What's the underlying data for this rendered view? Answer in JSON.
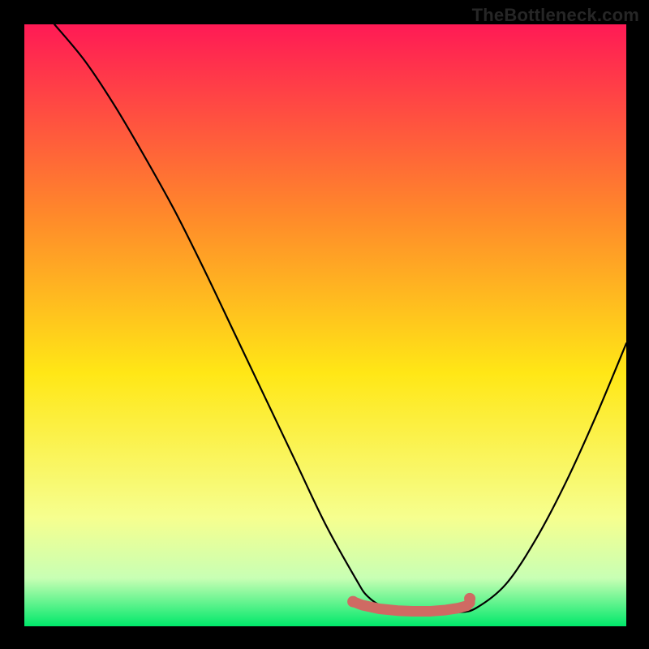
{
  "watermark": "TheBottleneck.com",
  "colors": {
    "bg": "#000000",
    "grad_top": "#ff1a55",
    "grad_mid1": "#ff8a2a",
    "grad_mid2": "#ffe716",
    "grad_low1": "#f6ff8f",
    "grad_low2": "#c8ffb4",
    "grad_bottom": "#00e86a",
    "curve": "#000000",
    "marker": "#cf6a63"
  },
  "chart_data": {
    "type": "line",
    "title": "",
    "xlabel": "",
    "ylabel": "",
    "xlim": [
      0,
      100
    ],
    "ylim": [
      0,
      100
    ],
    "curve_x": [
      5,
      10,
      15,
      20,
      25,
      30,
      35,
      40,
      45,
      50,
      55,
      57,
      60,
      63,
      66,
      69,
      72,
      75,
      80,
      85,
      90,
      95,
      100
    ],
    "curve_y": [
      100,
      94,
      86.5,
      78,
      69,
      59,
      48.5,
      38,
      27.5,
      17,
      8,
      5,
      3,
      2.3,
      2.1,
      2.1,
      2.3,
      3,
      7,
      14.5,
      24,
      35,
      47
    ],
    "markers_x": [
      54.6,
      56.2,
      59.0,
      62.0,
      64.5,
      67.5,
      70.0,
      72.0,
      73.5,
      74.0,
      74.0
    ],
    "markers_y": [
      4.1,
      3.5,
      2.9,
      2.6,
      2.5,
      2.5,
      2.7,
      3.0,
      3.4,
      3.9,
      4.6
    ]
  }
}
